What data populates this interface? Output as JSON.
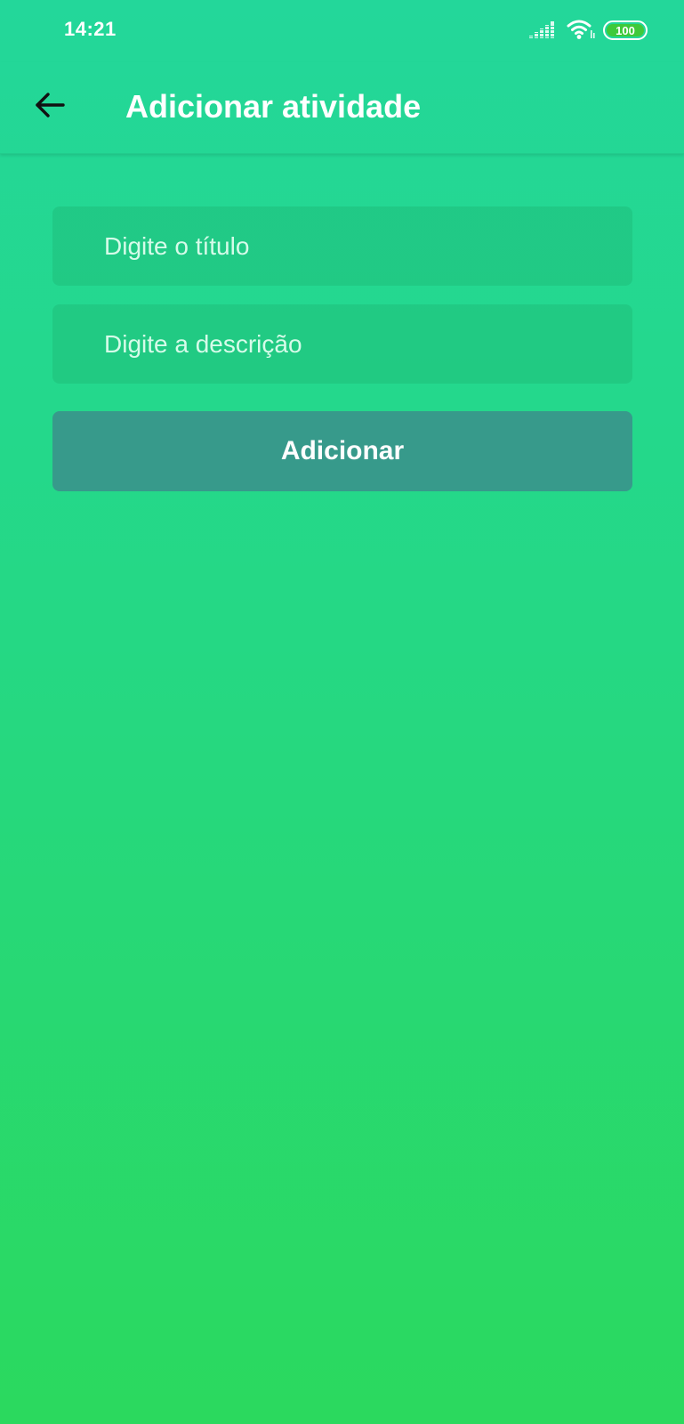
{
  "status_bar": {
    "time": "14:21",
    "battery_level": "100",
    "signal_icon": "cellular-signal-icon",
    "wifi_icon": "wifi-icon",
    "battery_icon": "battery-icon"
  },
  "header": {
    "back_icon": "arrow-left-icon",
    "title": "Adicionar atividade"
  },
  "form": {
    "title_input": {
      "value": "",
      "placeholder": "Digite o título"
    },
    "description_input": {
      "value": "",
      "placeholder": "Digite a descrição"
    },
    "submit_label": "Adicionar"
  },
  "colors": {
    "background_top": "#23d79a",
    "background_bottom": "#2bd95e",
    "button": "#379a8b",
    "text": "#ffffff",
    "battery_fill": "#3fc93a"
  }
}
